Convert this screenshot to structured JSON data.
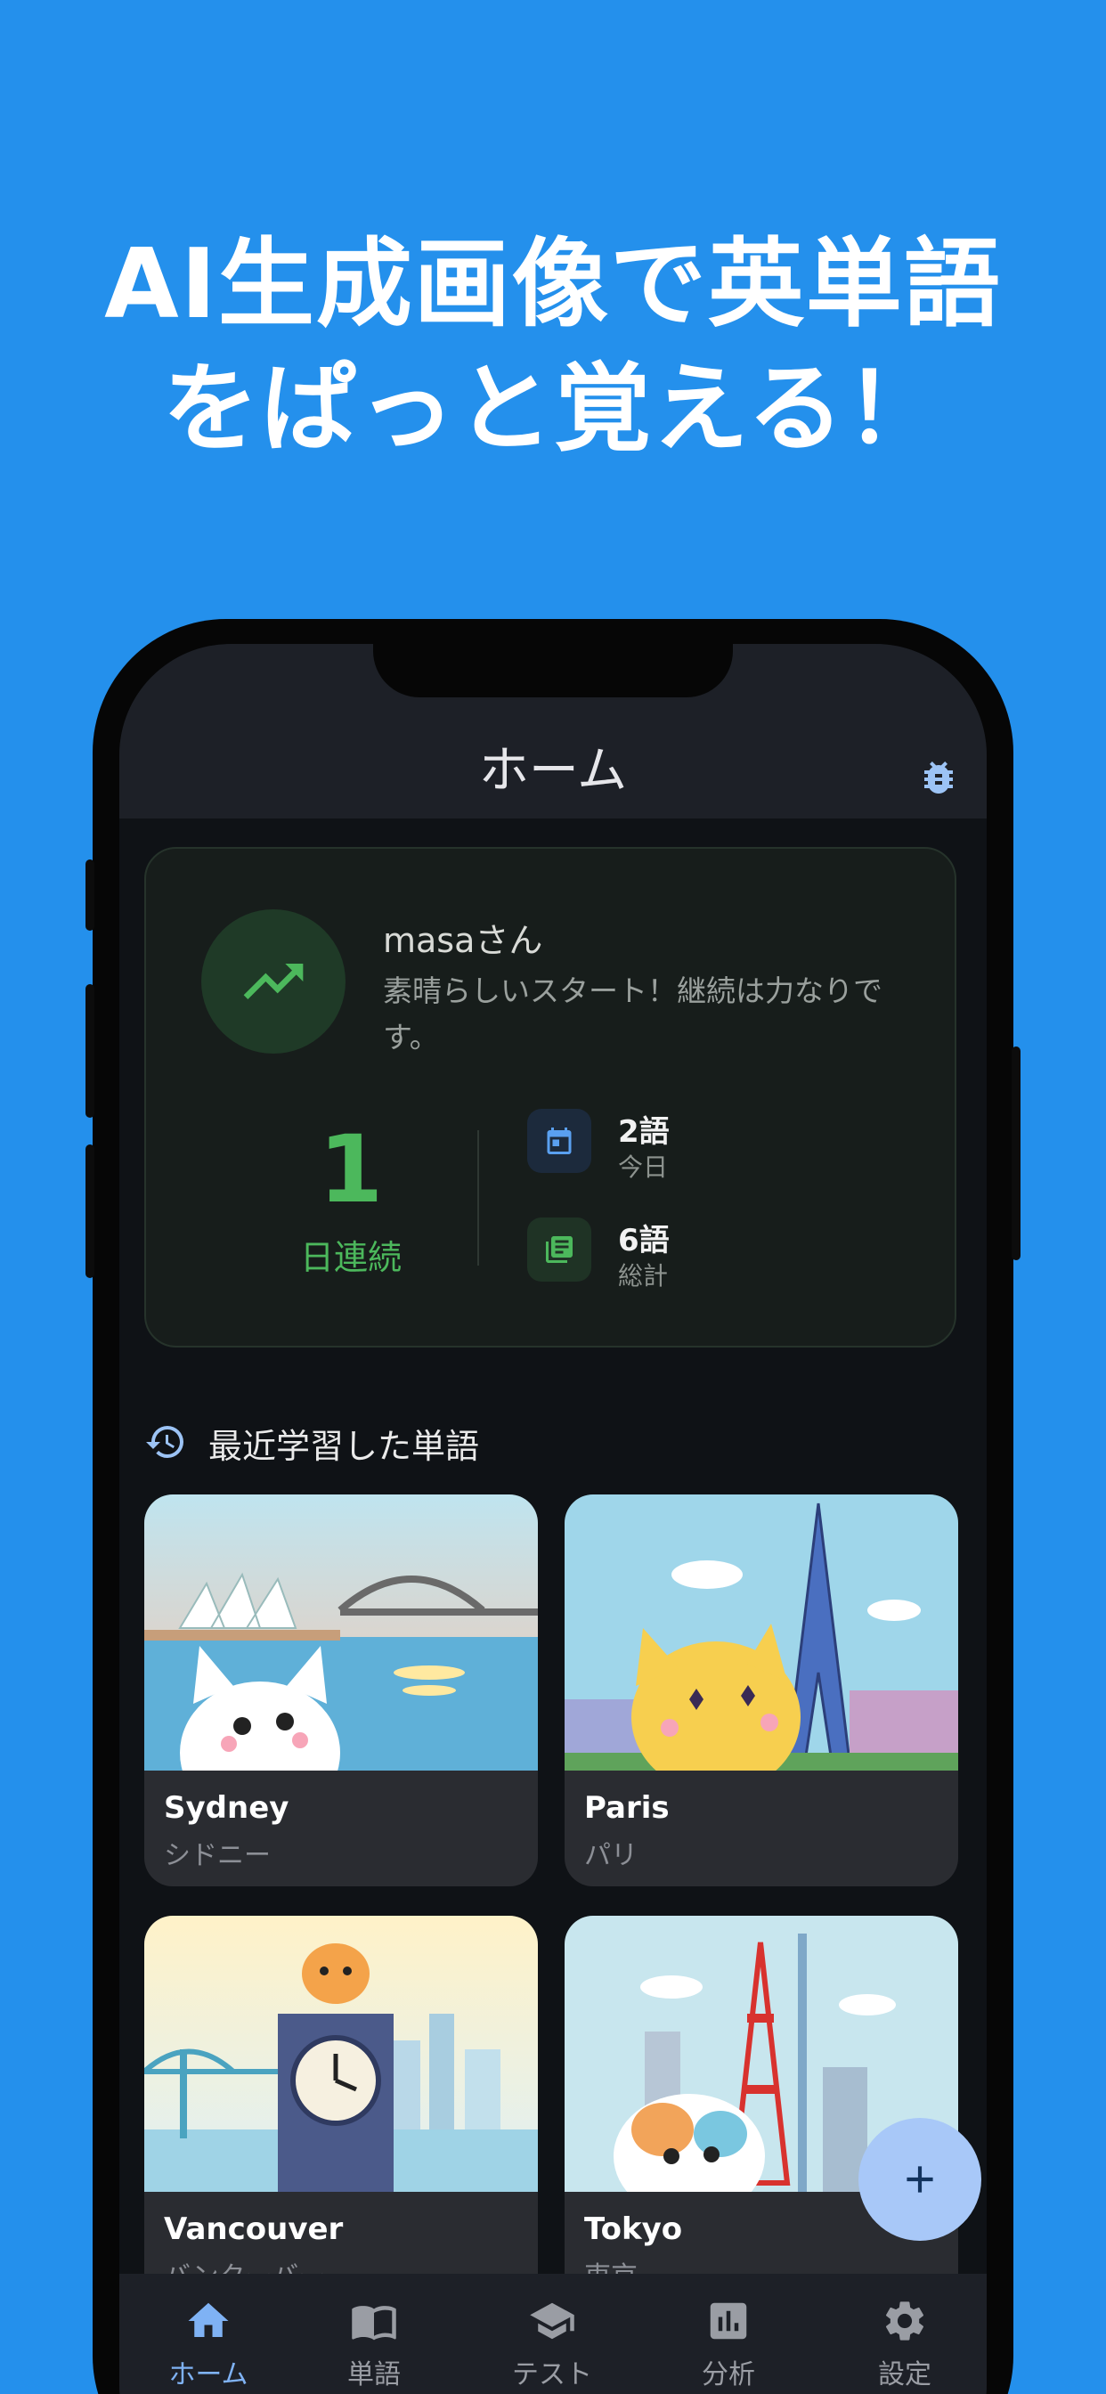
{
  "headline": {
    "line1": "AI生成画像で英単語",
    "line2": "をぱっと覚える！"
  },
  "appbar": {
    "title": "ホーム",
    "debug_icon": "bug-icon"
  },
  "profile": {
    "name": "masaさん",
    "message": "素晴らしいスタート！継続は力なりです。",
    "avatar_icon": "trending-up-icon"
  },
  "streak": {
    "count": "1",
    "label": "日連続"
  },
  "stats": [
    {
      "value": "2語",
      "label": "今日",
      "icon": "calendar-icon"
    },
    {
      "value": "6語",
      "label": "総計",
      "icon": "library-books-icon"
    }
  ],
  "recent": {
    "title": "最近学習した単語",
    "icon": "history-icon",
    "words": [
      {
        "en": "Sydney",
        "ja": "シドニー"
      },
      {
        "en": "Paris",
        "ja": "パリ"
      },
      {
        "en": "Vancouver",
        "ja": "バンクーバー"
      },
      {
        "en": "Tokyo",
        "ja": "東京"
      }
    ]
  },
  "nav": [
    {
      "label": "ホーム",
      "icon": "home-icon"
    },
    {
      "label": "単語",
      "icon": "book-icon"
    },
    {
      "label": "テスト",
      "icon": "school-icon"
    },
    {
      "label": "分析",
      "icon": "chart-icon"
    },
    {
      "label": "設定",
      "icon": "gear-icon"
    }
  ],
  "colors": {
    "background": "#2490ec",
    "accent_green": "#4cb85c",
    "accent_blue": "#7fb2f4",
    "fab": "#a8c8f8"
  }
}
